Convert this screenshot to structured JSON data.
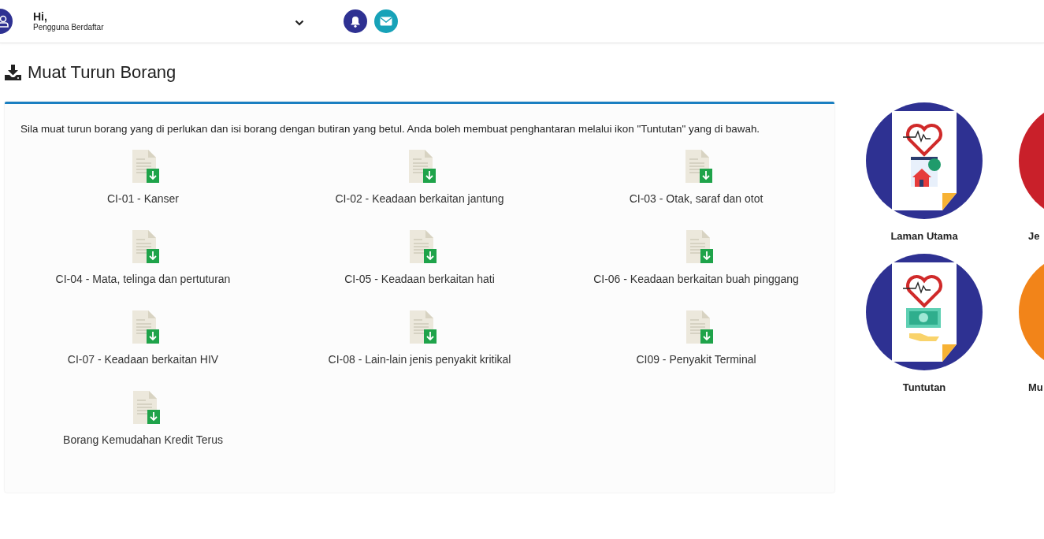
{
  "header": {
    "greeting": "Hi,",
    "role": "Pengguna Berdaftar"
  },
  "page_title": "Muat Turun Borang",
  "intro": "Sila muat turun borang yang di perlukan dan isi borang dengan butiran yang betul. Anda boleh membuat penghantaran melalui ikon \"Tuntutan\" yang di bawah.",
  "forms": [
    {
      "label": "CI-01 - Kanser"
    },
    {
      "label": "CI-02 - Keadaan berkaitan jantung"
    },
    {
      "label": "CI-03 - Otak, saraf dan otot"
    },
    {
      "label": "CI-04 - Mata, telinga dan pertuturan"
    },
    {
      "label": "CI-05 - Keadaan berkaitan hati"
    },
    {
      "label": "CI-06 - Keadaan berkaitan buah pinggang"
    },
    {
      "label": "CI-07 - Keadaan berkaitan HIV"
    },
    {
      "label": "CI-08 - Lain-lain jenis penyakit kritikal"
    },
    {
      "label": "CI09 - Penyakit Terminal"
    },
    {
      "label": "Borang Kemudahan Kredit Terus"
    }
  ],
  "tiles": [
    {
      "label": "Laman Utama",
      "color": "#2e3192",
      "kind": "home"
    },
    {
      "label": "Je",
      "color": "#c9202a",
      "kind": "clipped"
    },
    {
      "label": "Tuntutan",
      "color": "#2e3192",
      "kind": "claim"
    },
    {
      "label": "Mu",
      "color": "#f28419",
      "kind": "clipped"
    }
  ]
}
